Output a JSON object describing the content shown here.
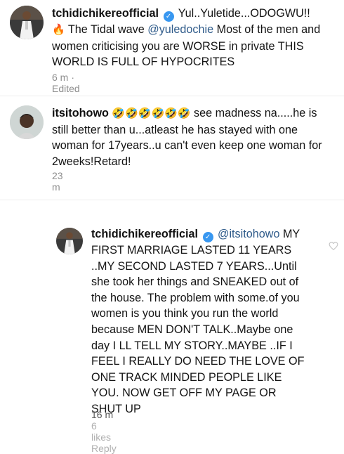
{
  "comments": [
    {
      "username": "tchidichikereofficial",
      "verified": true,
      "body_parts": {
        "a": "Yul..Yuletide...ODOGWU!!",
        "b": "The Tidal wave",
        "mention": "@yuledochie",
        "c": " Most of the men and women criticising you are WORSE in private THIS WORLD IS FULL OF HYPOCRITES"
      },
      "emoji": "🔥",
      "time": "6 m",
      "edited": "· Edited"
    },
    {
      "username": "itsitohowo",
      "verified": false,
      "emojis": "🤣🤣🤣🤣🤣🤣",
      "body": "see madness na.....he is still better than u...atleast he has stayed with one woman for 17years..u can't even keep one woman for 2weeks!Retard!",
      "time": "23 m"
    },
    {
      "username": "tchidichikereofficial",
      "verified": true,
      "mention": "@itsitohowo",
      "body": "MY FIRST MARRIAGE LASTED 11 YEARS ..MY SECOND LASTED 7 YEARS...Until she took her things and SNEAKED out of the house. The problem with some.of you women is you think you run the world because MEN DON'T TALK..Maybe one day I LL TELL MY STORY..MAYBE ..IF I FEEL I REALLY DO NEED THE LOVE OF ONE TRACK MINDED PEOPLE LIKE YOU. NOW GET OFF MY PAGE OR SHUT UP",
      "time": "16 m",
      "likes": "6 likes",
      "reply": "Reply"
    }
  ],
  "colors": {
    "verified": "#3897f0",
    "meta": "#8e8e8e",
    "mention": "#2f5b8a"
  },
  "icons": [
    "verified-badge-icon",
    "heart-icon",
    "fire-emoji",
    "laughing-emoji"
  ]
}
